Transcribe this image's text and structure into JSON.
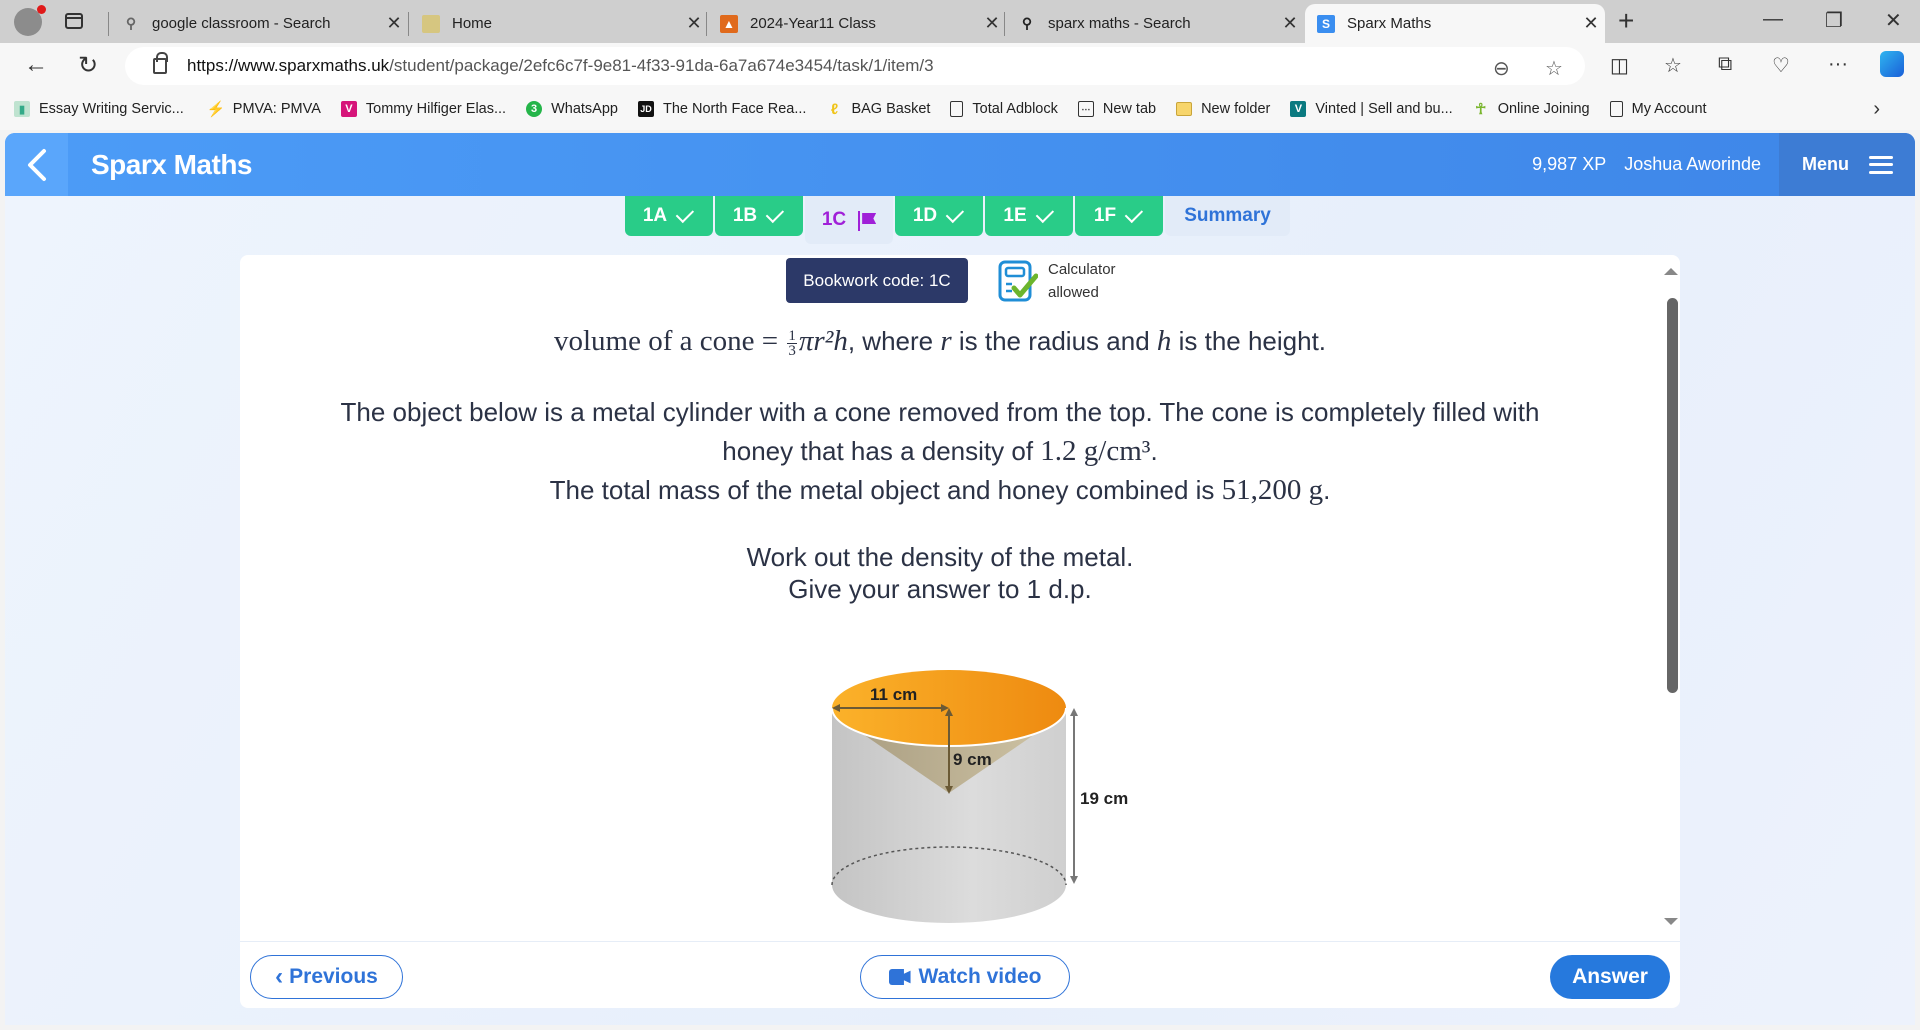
{
  "browser": {
    "tabs": [
      {
        "title": "google classroom - Search",
        "icon": "search-icon",
        "active": false
      },
      {
        "title": "Home",
        "icon": "classroom-icon",
        "active": false
      },
      {
        "title": "2024-Year11 Class",
        "icon": "classroom-class-icon",
        "active": false
      },
      {
        "title": "sparx maths - Search",
        "icon": "search-icon",
        "active": false
      },
      {
        "title": "Sparx Maths",
        "icon": "sparx-icon",
        "active": true
      }
    ],
    "url_host": "https://www.sparxmaths.uk",
    "url_path": "/student/package/2efc6c7f-9e81-4f33-91da-6a7a674e3454/task/1/item/3",
    "bookmarks": [
      {
        "label": "Essay Writing Servic...",
        "icon": "book-icon",
        "color": "#7fbf9f"
      },
      {
        "label": "PMVA: PMVA",
        "icon": "pmva-icon",
        "color": "#f08a1c"
      },
      {
        "label": "Tommy Hilfiger Elas...",
        "icon": "v-icon",
        "color": "#d6157a"
      },
      {
        "label": "WhatsApp",
        "icon": "whatsapp-icon",
        "color": "#25b54a"
      },
      {
        "label": "The North Face Rea...",
        "icon": "jd-icon",
        "color": "#111111"
      },
      {
        "label": "BAG Basket",
        "icon": "bag-icon",
        "color": "#f0c419"
      },
      {
        "label": "Total Adblock",
        "icon": "page-icon",
        "color": "#ffffff"
      },
      {
        "label": "New tab",
        "icon": "newtab-icon",
        "color": "#ffffff"
      },
      {
        "label": "New folder",
        "icon": "folder-icon",
        "color": "#f7d56b"
      },
      {
        "label": "Vinted | Sell and bu...",
        "icon": "vinted-icon",
        "color": "#0b7a80"
      },
      {
        "label": "Online Joining",
        "icon": "person-icon",
        "color": "#7ab62e"
      },
      {
        "label": "My Account",
        "icon": "page-icon",
        "color": "#ffffff"
      }
    ]
  },
  "header": {
    "title": "Sparx Maths",
    "xp": "9,987 XP",
    "user": "Joshua Aworinde",
    "menu_label": "Menu"
  },
  "task_tabs": [
    {
      "label": "1A",
      "status": "complete"
    },
    {
      "label": "1B",
      "status": "complete"
    },
    {
      "label": "1C",
      "status": "current-flagged"
    },
    {
      "label": "1D",
      "status": "complete"
    },
    {
      "label": "1E",
      "status": "complete"
    },
    {
      "label": "1F",
      "status": "complete"
    },
    {
      "label": "Summary",
      "status": "summary"
    }
  ],
  "question": {
    "bookwork_code": "Bookwork code: 1C",
    "calculator_line1": "Calculator",
    "calculator_line2": "allowed",
    "formula_lhs": "volume of a cone = ",
    "formula_num": "1",
    "formula_den": "3",
    "formula_rest": "πr²h",
    "formula_tail_1": ", where ",
    "formula_r": "r",
    "formula_tail_2": " is the radius and ",
    "formula_h": "h",
    "formula_tail_3": " is the height.",
    "line1": "The object below is a metal cylinder with a cone removed from the top. The cone is completely filled with",
    "line2_text": "honey that has a density of ",
    "line2_value": "1.2 g/cm³",
    "line2_end": ".",
    "line3_text": "The total mass of the metal object and honey combined is ",
    "line3_value": "51,200 g",
    "line3_end": ".",
    "line4": "Work out the density of the metal.",
    "line5": "Give your answer to 1 d.p."
  },
  "diagram": {
    "radius_label": "11 cm",
    "cone_depth_label": "9 cm",
    "height_label": "19 cm"
  },
  "footer": {
    "previous_label": "Previous",
    "watch_video_label": "Watch video",
    "answer_label": "Answer"
  }
}
